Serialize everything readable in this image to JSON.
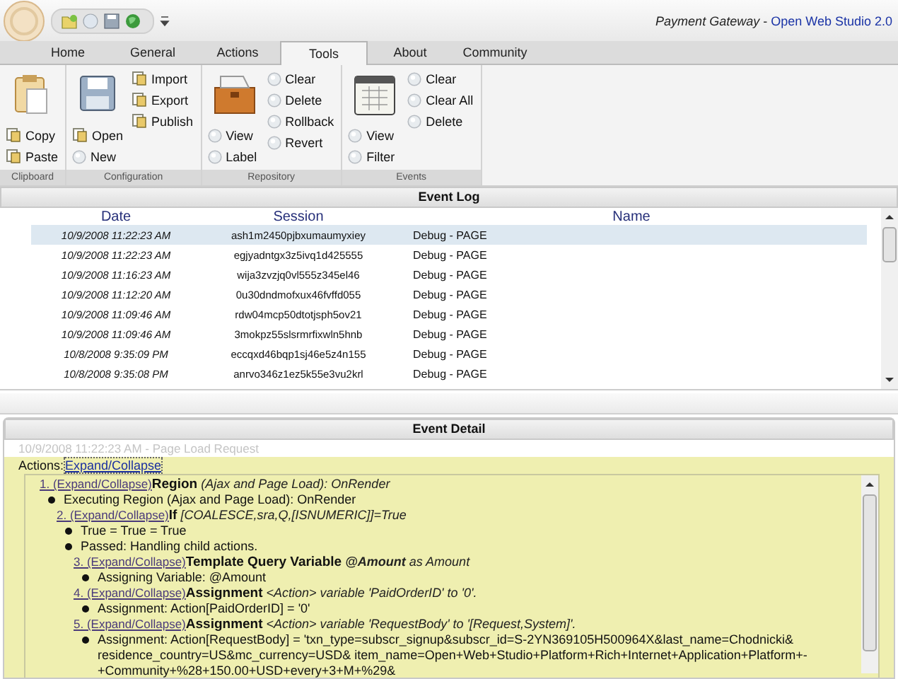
{
  "window": {
    "title": "Payment Gateway",
    "separator": "-",
    "app_name": "Open Web Studio 2.0"
  },
  "tabs": [
    {
      "label": "Home",
      "selected": false
    },
    {
      "label": "General",
      "selected": false
    },
    {
      "label": "Actions",
      "selected": false
    },
    {
      "label": "Tools",
      "selected": true
    },
    {
      "label": "About",
      "selected": false
    },
    {
      "label": "Community",
      "selected": false
    }
  ],
  "ribbon": [
    {
      "label": "Clipboard",
      "columns": [
        [
          {
            "label": "Copy",
            "kind": "icon"
          },
          {
            "label": "Paste",
            "kind": "icon"
          }
        ]
      ]
    },
    {
      "label": "Configuration",
      "columns": [
        [
          {
            "label": "Open",
            "kind": "icon"
          },
          {
            "label": "New",
            "kind": "bullet"
          }
        ],
        [
          {
            "label": "Import",
            "kind": "icon"
          },
          {
            "label": "Export",
            "kind": "icon"
          },
          {
            "label": "Publish",
            "kind": "icon"
          }
        ]
      ]
    },
    {
      "label": "Repository",
      "columns": [
        [
          {
            "label": "View",
            "kind": "bullet"
          },
          {
            "label": "Label",
            "kind": "bullet"
          }
        ],
        [
          {
            "label": "Clear",
            "kind": "bullet"
          },
          {
            "label": "Delete",
            "kind": "bullet"
          },
          {
            "label": "Rollback",
            "kind": "bullet"
          },
          {
            "label": "Revert",
            "kind": "bullet"
          }
        ]
      ]
    },
    {
      "label": "Events",
      "columns": [
        [
          {
            "label": "View",
            "kind": "bullet"
          },
          {
            "label": "Filter",
            "kind": "bullet"
          }
        ],
        [
          {
            "label": "Clear",
            "kind": "bullet"
          },
          {
            "label": "Clear All",
            "kind": "bullet"
          },
          {
            "label": "Delete",
            "kind": "bullet"
          }
        ]
      ]
    }
  ],
  "event_log": {
    "title": "Event Log",
    "columns": [
      "Date",
      "Session",
      "Name"
    ],
    "rows": [
      {
        "date": "10/9/2008 *11:22:23 AM*",
        "session": "ash1m2450pjbxumaumyxiey",
        "name": "Debug - PAGE",
        "selected": true
      },
      {
        "date": "10/9/2008 *11:22:23 AM*",
        "session": "egjyadntgx3z5ivq1d425555",
        "name": "Debug - PAGE",
        "selected": false
      },
      {
        "date": "10/9/2008 *11:16:23 AM*",
        "session": "wija3zvzjq0vl555z345el46",
        "name": "Debug - PAGE",
        "selected": false
      },
      {
        "date": "10/9/2008 *11:12:20 AM*",
        "session": "0u30dndmofxux46fvffd055",
        "name": "Debug - PAGE",
        "selected": false
      },
      {
        "date": "10/9/2008 *11:09:46 AM*",
        "session": "rdw04mcp50dtotjsph5ov21",
        "name": "Debug - PAGE",
        "selected": false
      },
      {
        "date": "10/9/2008 *11:09:46 AM*",
        "session": "3mokpz55slsrmrfixwln5hnb",
        "name": "Debug - PAGE",
        "selected": false
      },
      {
        "date": "10/8/2008 9:35:09 *PM*",
        "session": "eccqxd46bqp1sj46e5z4n155",
        "name": "Debug - PAGE",
        "selected": false
      },
      {
        "date": "10/8/2008 9:35:08 *PM*",
        "session": "anrvo346z1ez5k55e3vu2krl",
        "name": "Debug - PAGE",
        "selected": false
      }
    ]
  },
  "event_detail": {
    "title": "Event Detail",
    "subtitle": "10/9/2008 11:22:23 AM - Page Load Request",
    "actions_label": "Actions:",
    "actions_link": "Expand/Collapse",
    "steps": [
      {
        "kind": "heading",
        "link": "1. (Expand/Collapse)",
        "title": "Region",
        "detail": "(Ajax and Page Load): OnRender",
        "children": [
          {
            "kind": "bullet",
            "text": "Executing Region (Ajax and Page Load): OnRender"
          },
          {
            "kind": "heading",
            "link": "2. (Expand/Collapse)",
            "title": "If",
            "detail": "[COALESCE,sra,Q,[ISNUMERIC]]=True",
            "children": [
              {
                "kind": "bullet",
                "text": "True = True = True"
              },
              {
                "kind": "bullet",
                "text": "Passed: Handling child actions."
              },
              {
                "kind": "heading",
                "link": "3. (Expand/Collapse)",
                "title": "Template Query Variable",
                "detail": "**@Amount** as Amount",
                "children": [
                  {
                    "kind": "bullet",
                    "text": "Assigning Variable: @Amount"
                  }
                ]
              },
              {
                "kind": "heading",
                "link": "4. (Expand/Collapse)",
                "title": "Assignment",
                "detail": "<Action> variable 'PaidOrderID' to '0'.",
                "children": [
                  {
                    "kind": "bullet",
                    "text": "Assignment: Action[PaidOrderID] = '0'"
                  }
                ]
              },
              {
                "kind": "heading",
                "link": "5. (Expand/Collapse)",
                "title": "Assignment",
                "detail": "<Action> variable 'RequestBody' to '[Request,System]'.",
                "children": [
                  {
                    "kind": "bullet",
                    "text": "Assignment: Action[RequestBody] = 'txn_type=subscr_signup&subscr_id=S-2YN369105H500964X&last_name=Chodnicki& residence_country=US&mc_currency=USD& item_name=Open+Web+Studio+Platform+Rich+Internet+Application+Platform+-+Community+%28+150.00+USD+every+3+M+%29&"
                  }
                ]
              }
            ]
          }
        ]
      }
    ]
  }
}
